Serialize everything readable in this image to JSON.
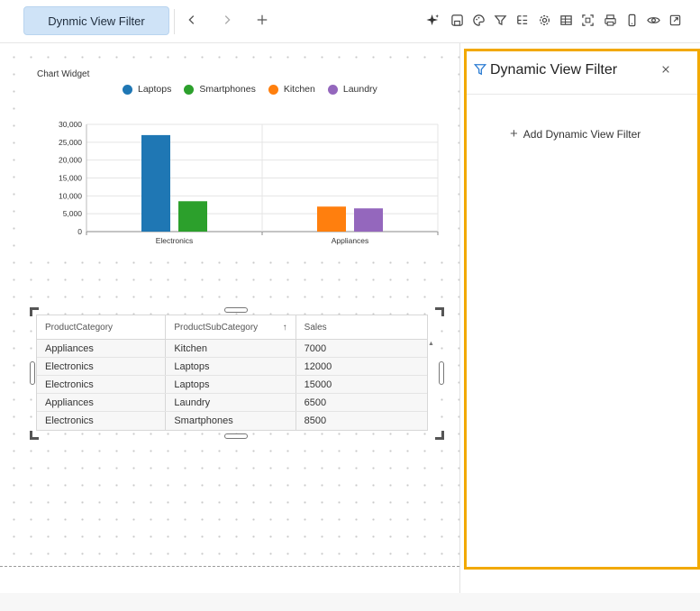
{
  "toolbar": {
    "active_tab": "Dynmic View Filter",
    "icons": [
      "sparkle-icon",
      "save-icon",
      "palette-icon",
      "filter-icon",
      "hierarchy-icon",
      "settings-icon",
      "table-icon",
      "focus-icon",
      "print-icon",
      "mobile-icon",
      "preview-icon",
      "export-icon"
    ]
  },
  "chart": {
    "title": "Chart Widget",
    "legend": [
      {
        "name": "Laptops",
        "color": "#1f77b4"
      },
      {
        "name": "Smartphones",
        "color": "#2ca02c"
      },
      {
        "name": "Kitchen",
        "color": "#ff7f0e"
      },
      {
        "name": "Laundry",
        "color": "#9467bd"
      }
    ]
  },
  "chart_data": {
    "type": "bar",
    "title": "Chart Widget",
    "categories": [
      "Electronics",
      "Appliances"
    ],
    "series": [
      {
        "name": "Laptops",
        "values": [
          27000,
          null
        ]
      },
      {
        "name": "Smartphones",
        "values": [
          8500,
          null
        ]
      },
      {
        "name": "Kitchen",
        "values": [
          null,
          7000
        ]
      },
      {
        "name": "Laundry",
        "values": [
          null,
          6500
        ]
      }
    ],
    "yticks": [
      "0",
      "5,000",
      "10,000",
      "15,000",
      "20,000",
      "25,000",
      "30,000"
    ],
    "ylim": [
      0,
      30000
    ],
    "grid": true,
    "legend_position": "top"
  },
  "table": {
    "columns": [
      "ProductCategory",
      "ProductSubCategory",
      "Sales"
    ],
    "rows": [
      [
        "Appliances",
        "Kitchen",
        "7000"
      ],
      [
        "Electronics",
        "Laptops",
        "12000"
      ],
      [
        "Electronics",
        "Laptops",
        "15000"
      ],
      [
        "Appliances",
        "Laundry",
        "6500"
      ],
      [
        "Electronics",
        "Smartphones",
        "8500"
      ]
    ]
  },
  "panel": {
    "title": "Dynamic View Filter",
    "add_label": "Add Dynamic View Filter",
    "accent": "#f2a900"
  }
}
